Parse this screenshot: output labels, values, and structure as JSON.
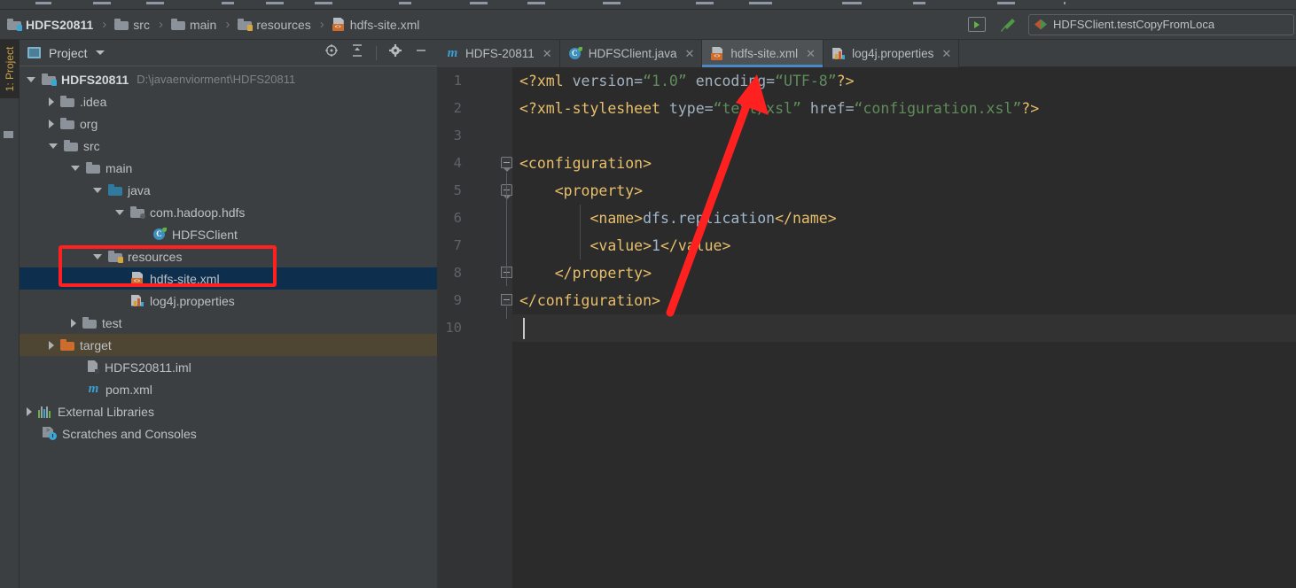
{
  "window": {
    "menu_strip_items": 14
  },
  "breadcrumb": {
    "items": [
      {
        "label": "HDFS20811",
        "icon": "module-folder-icon"
      },
      {
        "label": "src",
        "icon": "folder-icon"
      },
      {
        "label": "main",
        "icon": "folder-icon"
      },
      {
        "label": "resources",
        "icon": "resources-folder-icon"
      },
      {
        "label": "hdfs-site.xml",
        "icon": "xml-file-icon"
      }
    ],
    "separator": "›"
  },
  "toolbar_right": {
    "run_button": "run-icon",
    "build_button": "build-hammer-icon",
    "run_config": "HDFSClient.testCopyFromLoca"
  },
  "tool_strip": {
    "vertical_tab": "1: Project"
  },
  "project_panel": {
    "title": "Project",
    "actions": [
      "locate-icon",
      "collapse-all-icon",
      "settings-gear-icon",
      "hide-icon"
    ],
    "tree": [
      {
        "label": "HDFS20811",
        "path": "D:\\javaenviorment\\HDFS20811",
        "icon": "module-folder-icon",
        "indent": 0,
        "twist": "open",
        "bold": true,
        "state": "normal"
      },
      {
        "label": ".idea",
        "path": "",
        "icon": "folder-icon",
        "indent": 1,
        "twist": "closed",
        "bold": false,
        "state": "normal"
      },
      {
        "label": "org",
        "path": "",
        "icon": "folder-icon",
        "indent": 1,
        "twist": "closed",
        "bold": false,
        "state": "normal"
      },
      {
        "label": "src",
        "path": "",
        "icon": "folder-icon",
        "indent": 1,
        "twist": "open",
        "bold": false,
        "state": "normal"
      },
      {
        "label": "main",
        "path": "",
        "icon": "folder-icon",
        "indent": 2,
        "twist": "open",
        "bold": false,
        "state": "normal"
      },
      {
        "label": "java",
        "path": "",
        "icon": "source-folder-icon",
        "indent": 3,
        "twist": "open",
        "bold": false,
        "state": "normal"
      },
      {
        "label": "com.hadoop.hdfs",
        "path": "",
        "icon": "package-icon",
        "indent": 4,
        "twist": "open",
        "bold": false,
        "state": "normal"
      },
      {
        "label": "HDFSClient",
        "path": "",
        "icon": "java-class-icon",
        "indent": 5,
        "twist": "none",
        "bold": false,
        "state": "normal"
      },
      {
        "label": "resources",
        "path": "",
        "icon": "resources-folder-icon",
        "indent": 3,
        "twist": "open",
        "bold": false,
        "state": "normal"
      },
      {
        "label": "hdfs-site.xml",
        "path": "",
        "icon": "xml-file-icon",
        "indent": 4,
        "twist": "none",
        "bold": false,
        "state": "selected"
      },
      {
        "label": "log4j.properties",
        "path": "",
        "icon": "properties-file-icon",
        "indent": 4,
        "twist": "none",
        "bold": false,
        "state": "normal"
      },
      {
        "label": "test",
        "path": "",
        "icon": "folder-icon",
        "indent": 2,
        "twist": "closed",
        "bold": false,
        "state": "normal"
      },
      {
        "label": "target",
        "path": "",
        "icon": "excluded-folder-icon",
        "indent": 1,
        "twist": "closed",
        "bold": false,
        "state": "excluded"
      },
      {
        "label": "HDFS20811.iml",
        "path": "",
        "icon": "iml-file-icon",
        "indent": 2,
        "twist": "none",
        "bold": false,
        "state": "normal"
      },
      {
        "label": "pom.xml",
        "path": "",
        "icon": "maven-file-icon",
        "indent": 2,
        "twist": "none",
        "bold": false,
        "state": "normal"
      },
      {
        "label": "External Libraries",
        "path": "",
        "icon": "libraries-icon",
        "indent": 0,
        "twist": "closed",
        "bold": false,
        "state": "normal"
      },
      {
        "label": "Scratches and Consoles",
        "path": "",
        "icon": "scratches-icon",
        "indent": 0,
        "twist": "none",
        "bold": false,
        "state": "normal"
      }
    ]
  },
  "editor": {
    "tabs": [
      {
        "label": "HDFS-20811",
        "icon": "maven-file-icon",
        "active": false,
        "closable": true
      },
      {
        "label": "HDFSClient.java",
        "icon": "java-class-icon",
        "active": false,
        "closable": true
      },
      {
        "label": "hdfs-site.xml",
        "icon": "xml-file-icon",
        "active": true,
        "closable": true
      },
      {
        "label": "log4j.properties",
        "icon": "properties-file-icon",
        "active": false,
        "closable": true
      }
    ],
    "close_glyph": "✕",
    "line_numbers": [
      "1",
      "2",
      "3",
      "4",
      "5",
      "6",
      "7",
      "8",
      "9",
      "10"
    ],
    "current_line": 10,
    "lines": [
      {
        "n": 1,
        "tokens": [
          {
            "t": "<?xml ",
            "c": "tag"
          },
          {
            "t": "version=",
            "c": "attr"
          },
          {
            "t": "“1.0”",
            "c": "val"
          },
          {
            "t": " encoding=",
            "c": "attr"
          },
          {
            "t": "“UTF-8”",
            "c": "val"
          },
          {
            "t": "?>",
            "c": "tag"
          }
        ]
      },
      {
        "n": 2,
        "tokens": [
          {
            "t": "<?xml-stylesheet ",
            "c": "tag"
          },
          {
            "t": "type=",
            "c": "attr"
          },
          {
            "t": "“text/xsl”",
            "c": "val"
          },
          {
            "t": " href=",
            "c": "attr"
          },
          {
            "t": "“configuration.xsl”",
            "c": "val"
          },
          {
            "t": "?>",
            "c": "tag"
          }
        ]
      },
      {
        "n": 3,
        "tokens": []
      },
      {
        "n": 4,
        "tokens": [
          {
            "t": "<configuration>",
            "c": "tag"
          }
        ]
      },
      {
        "n": 5,
        "tokens": [
          {
            "t": "    <property>",
            "c": "tag"
          }
        ]
      },
      {
        "n": 6,
        "tokens": [
          {
            "t": "        <name>",
            "c": "tag"
          },
          {
            "t": "dfs.replication",
            "c": "txt"
          },
          {
            "t": "</name>",
            "c": "tag"
          }
        ]
      },
      {
        "n": 7,
        "tokens": [
          {
            "t": "        <value>",
            "c": "tag"
          },
          {
            "t": "1",
            "c": "num"
          },
          {
            "t": "</value>",
            "c": "tag"
          }
        ]
      },
      {
        "n": 8,
        "tokens": [
          {
            "t": "    </property>",
            "c": "tag"
          }
        ]
      },
      {
        "n": 9,
        "tokens": [
          {
            "t": "</configuration>",
            "c": "tag"
          }
        ]
      },
      {
        "n": 10,
        "tokens": []
      }
    ]
  },
  "annotations": {
    "rect_label": "highlight-resources-and-hdfs-site-xml",
    "arrow_label": "arrow-pointing-to-encoding-attribute",
    "color": "#ff2020"
  },
  "colors": {
    "accent_blue": "#4a88c7",
    "selection_blue": "#0d2f4d",
    "excluded_olive": "#4e4632",
    "panel_bg": "#3c3f41",
    "editor_bg": "#2b2b2b",
    "gutter_bg": "#313335",
    "tag_orange": "#e8bf6a",
    "value_green": "#5f8c5a",
    "text_blue": "#9fb6cc",
    "annotation_red": "#ff2020"
  }
}
